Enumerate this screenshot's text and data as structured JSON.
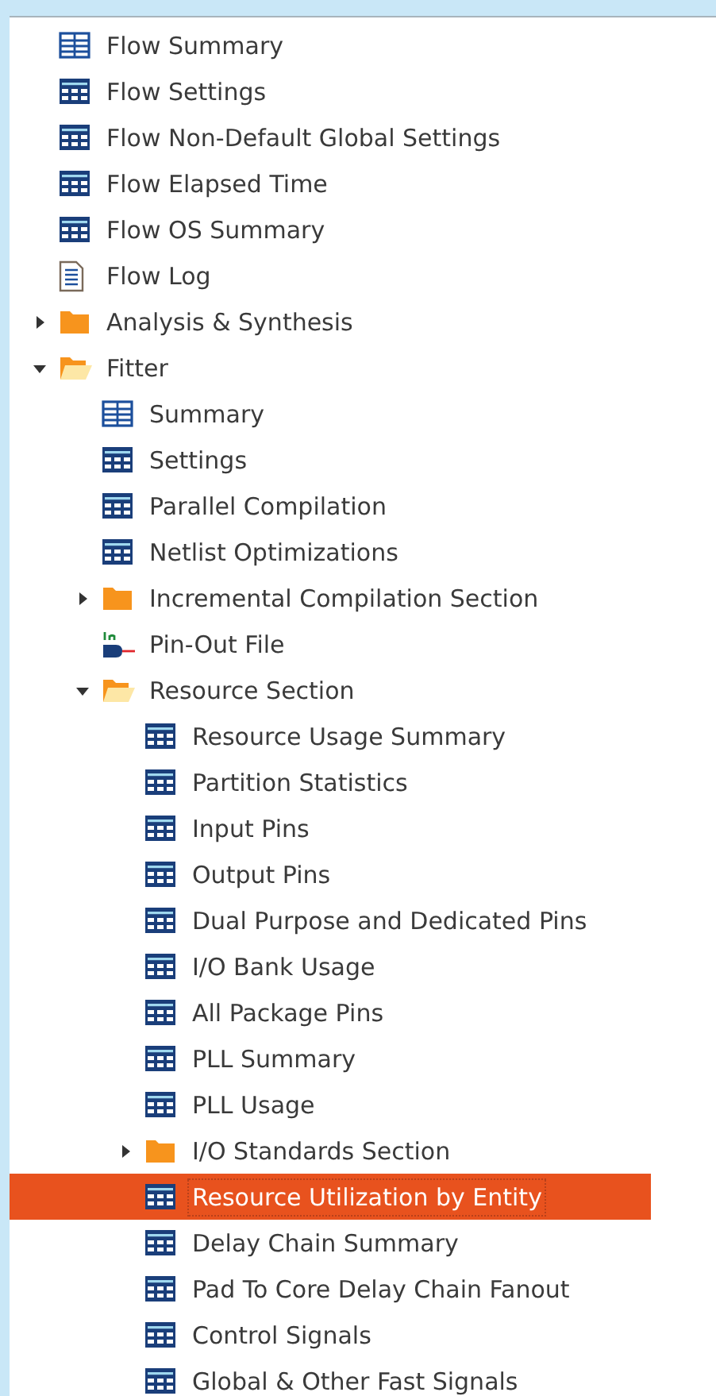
{
  "tree": [
    {
      "label": "Flow Summary",
      "kind": "grid",
      "selected": false
    },
    {
      "label": "Flow Settings",
      "kind": "table",
      "selected": false
    },
    {
      "label": "Flow Non-Default Global Settings",
      "kind": "table",
      "selected": false
    },
    {
      "label": "Flow Elapsed Time",
      "kind": "table",
      "selected": false
    },
    {
      "label": "Flow OS Summary",
      "kind": "table",
      "selected": false
    },
    {
      "label": "Flow Log",
      "kind": "log",
      "selected": false
    },
    {
      "label": "Analysis & Synthesis",
      "kind": "folder",
      "selected": false,
      "expanded": false
    },
    {
      "label": "Fitter",
      "kind": "folder",
      "selected": false,
      "expanded": true,
      "children": [
        {
          "label": "Summary",
          "kind": "grid",
          "selected": false
        },
        {
          "label": "Settings",
          "kind": "table",
          "selected": false
        },
        {
          "label": "Parallel Compilation",
          "kind": "table",
          "selected": false
        },
        {
          "label": "Netlist Optimizations",
          "kind": "table",
          "selected": false
        },
        {
          "label": "Incremental Compilation Section",
          "kind": "folder",
          "selected": false,
          "expanded": false
        },
        {
          "label": "Pin-Out File",
          "kind": "pin",
          "selected": false
        },
        {
          "label": "Resource Section",
          "kind": "folder",
          "selected": false,
          "expanded": true,
          "children": [
            {
              "label": "Resource Usage Summary",
              "kind": "table",
              "selected": false
            },
            {
              "label": "Partition Statistics",
              "kind": "table",
              "selected": false
            },
            {
              "label": "Input Pins",
              "kind": "table",
              "selected": false
            },
            {
              "label": "Output Pins",
              "kind": "table",
              "selected": false
            },
            {
              "label": "Dual Purpose and Dedicated Pins",
              "kind": "table",
              "selected": false
            },
            {
              "label": "I/O Bank Usage",
              "kind": "table",
              "selected": false
            },
            {
              "label": "All Package Pins",
              "kind": "table",
              "selected": false
            },
            {
              "label": "PLL Summary",
              "kind": "table",
              "selected": false
            },
            {
              "label": "PLL Usage",
              "kind": "table",
              "selected": false
            },
            {
              "label": "I/O Standards Section",
              "kind": "folder",
              "selected": false,
              "expanded": false
            },
            {
              "label": "Resource Utilization by Entity",
              "kind": "table",
              "selected": true
            },
            {
              "label": "Delay Chain Summary",
              "kind": "table",
              "selected": false
            },
            {
              "label": "Pad To Core Delay Chain Fanout",
              "kind": "table",
              "selected": false
            },
            {
              "label": "Control Signals",
              "kind": "table",
              "selected": false
            },
            {
              "label": "Global & Other Fast Signals",
              "kind": "table",
              "selected": false
            }
          ]
        }
      ]
    }
  ]
}
